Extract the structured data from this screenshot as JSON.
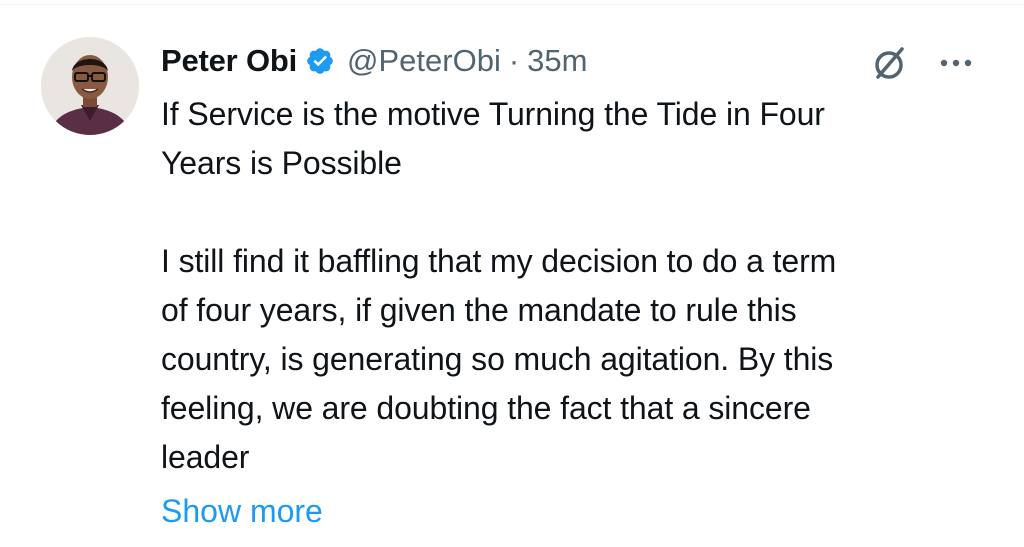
{
  "tweet": {
    "author": {
      "display_name": "Peter Obi",
      "handle": "@PeterObi",
      "verified": true,
      "verified_icon": "verified-badge-icon",
      "avatar": "avatar"
    },
    "separator": "·",
    "timestamp": "35m",
    "text": "If Service is the motive Turning the Tide in Four\nYears is Possible\n\nI still find it baffling that my decision to do a term\nof four years, if given the mandate to rule this\ncountry, is generating so much agitation. By this\nfeeling, we are doubting the fact that a sincere\nleader",
    "show_more_label": "Show more",
    "icons": {
      "grok": "grok-icon",
      "more": "more-options-icon"
    }
  },
  "colors": {
    "text_primary": "#0f1419",
    "text_secondary": "#536471",
    "link": "#1d9bf0",
    "verified": "#1d9bf0"
  }
}
